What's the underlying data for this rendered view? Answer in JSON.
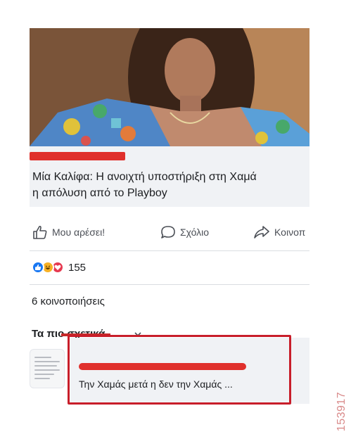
{
  "post": {
    "headline_line1": "Μία Καλίφα: Η ανοιχτή υποστήριξη στη Χαμά",
    "headline_line2": "η απόλυση από το Playboy"
  },
  "actions": {
    "like_label": "Μου αρέσει!",
    "comment_label": "Σχόλιο",
    "share_label": "Κοινοπ"
  },
  "reactions": {
    "icons": [
      "like-icon",
      "haha-icon",
      "love-icon"
    ],
    "count": "155"
  },
  "shares": {
    "text": "6 κοινοποιήσεις"
  },
  "related": {
    "title": "Τα πιο σχετικά",
    "item_text": "Την Χαμάς μετά η δεν την Χαμάς ..."
  },
  "watermark": {
    "text": "153917"
  },
  "colors": {
    "redaction": "#e0302c",
    "highlight_border": "#c81e2a",
    "like_blue": "#1877f2",
    "background_gray": "#f0f2f5"
  }
}
